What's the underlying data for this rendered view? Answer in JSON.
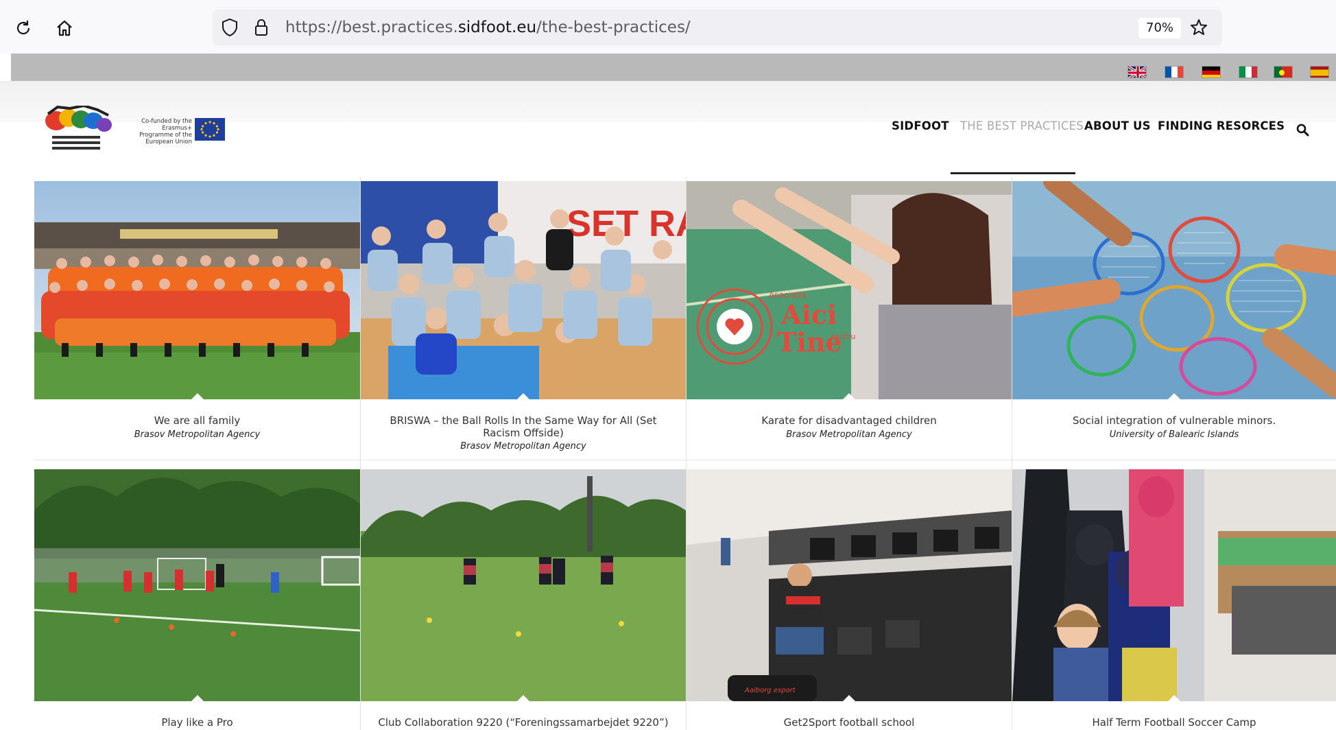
{
  "browser": {
    "url_prefix": "https://best.practices.",
    "url_domain": "sidfoot.eu",
    "url_path": "/the-best-practices/",
    "zoom": "70%"
  },
  "site": {
    "eu_text": "Co-funded by the Erasmus+ Programme of the European Union",
    "nav": [
      {
        "label": "SIDFOOT",
        "active": false
      },
      {
        "label": "THE BEST PRACTICES",
        "active": true
      },
      {
        "label": "ABOUT US",
        "active": false
      },
      {
        "label": "FINDING RESORCES",
        "active": false
      }
    ],
    "languages": [
      "en",
      "fr",
      "de",
      "it",
      "pt",
      "es"
    ]
  },
  "practices": [
    {
      "title": "We are all family",
      "org": "Brasov Metropolitan Agency"
    },
    {
      "title": "BRISWA – the Ball Rolls In the Same Way for All (Set Racism Offside)",
      "org": "Brasov Metropolitan Agency"
    },
    {
      "title": "Karate for disadvantaged children",
      "org": "Brasov Metropolitan Agency"
    },
    {
      "title": "Social integration of vulnerable minors.",
      "org": "University of Balearic Islands"
    },
    {
      "title": "Play like a Pro",
      "org": ""
    },
    {
      "title": "Club Collaboration 9220 (“Foreningssamarbejdet 9220”)",
      "org": ""
    },
    {
      "title": "Get2Sport football school",
      "org": ""
    },
    {
      "title": "Half Term Football Soccer Camp",
      "org": ""
    }
  ],
  "photo_text": {
    "set_racism": "SET RACISM",
    "aici_1": "Aici",
    "aici_2": "Tine",
    "asociatia": "Asociația",
    "pentru": "pentru",
    "esport": "Aalborg esport"
  }
}
